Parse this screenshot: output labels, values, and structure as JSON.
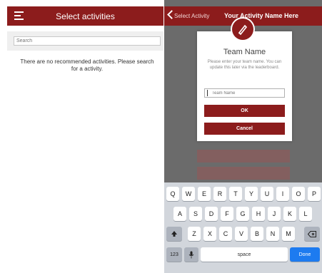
{
  "left": {
    "header": {
      "title": "Select activities",
      "menu_icon": "hamburger-menu-icon"
    },
    "search": {
      "placeholder": "Search"
    },
    "empty_message": "There are no recommended activities. Please search for a activity."
  },
  "right": {
    "header": {
      "back_label": "Select Activity",
      "title": "Your Activity Name Here",
      "back_icon": "chevron-left-icon"
    },
    "dialog": {
      "badge_icon": "pencil-icon",
      "title": "Team Name",
      "message": "Please enter your team name. You can update this later via the leaderboard.",
      "input_placeholder": "Team Name",
      "ok_label": "OK",
      "cancel_label": "Cancel"
    },
    "keyboard": {
      "row1": [
        "Q",
        "W",
        "E",
        "R",
        "T",
        "Y",
        "U",
        "I",
        "O",
        "P"
      ],
      "row2": [
        "A",
        "S",
        "D",
        "F",
        "G",
        "H",
        "J",
        "K",
        "L"
      ],
      "row3": [
        "Z",
        "X",
        "C",
        "V",
        "B",
        "N",
        "M"
      ],
      "shift_icon": "shift-icon",
      "backspace_icon": "backspace-icon",
      "numbers_label": "123",
      "mic_icon": "microphone-icon",
      "space_label": "space",
      "done_label": "Done"
    }
  },
  "colors": {
    "brand": "#8c1c1c",
    "keyboard_done": "#1d7bf0"
  }
}
